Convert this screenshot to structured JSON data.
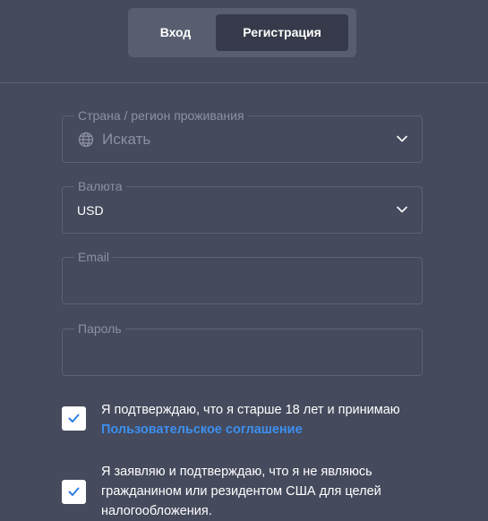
{
  "tabs": {
    "login_label": "Вход",
    "register_label": "Регистрация",
    "active": "Регистрация"
  },
  "form": {
    "country": {
      "label": "Страна / регион проживания",
      "placeholder": "Искать",
      "icon": "globe-icon",
      "dropdown_icon": "chevron-down-icon"
    },
    "currency": {
      "label": "Валюта",
      "value": "USD",
      "dropdown_icon": "chevron-down-icon"
    },
    "email": {
      "label": "Email",
      "value": ""
    },
    "password": {
      "label": "Пароль",
      "value": ""
    }
  },
  "consents": [
    {
      "checked": true,
      "text": "Я подтверждаю, что я старше 18 лет и принимаю",
      "link": "Пользовательское соглашение"
    },
    {
      "checked": true,
      "text": "Я заявляю и подтверждаю, что я не являюсь гражданином или резидентом США для целей налогообложения."
    }
  ],
  "colors": {
    "background": "#454a5c",
    "active_tab": "#363a4a",
    "link": "#3d8ff0",
    "checkmark": "#2f7fe0"
  }
}
